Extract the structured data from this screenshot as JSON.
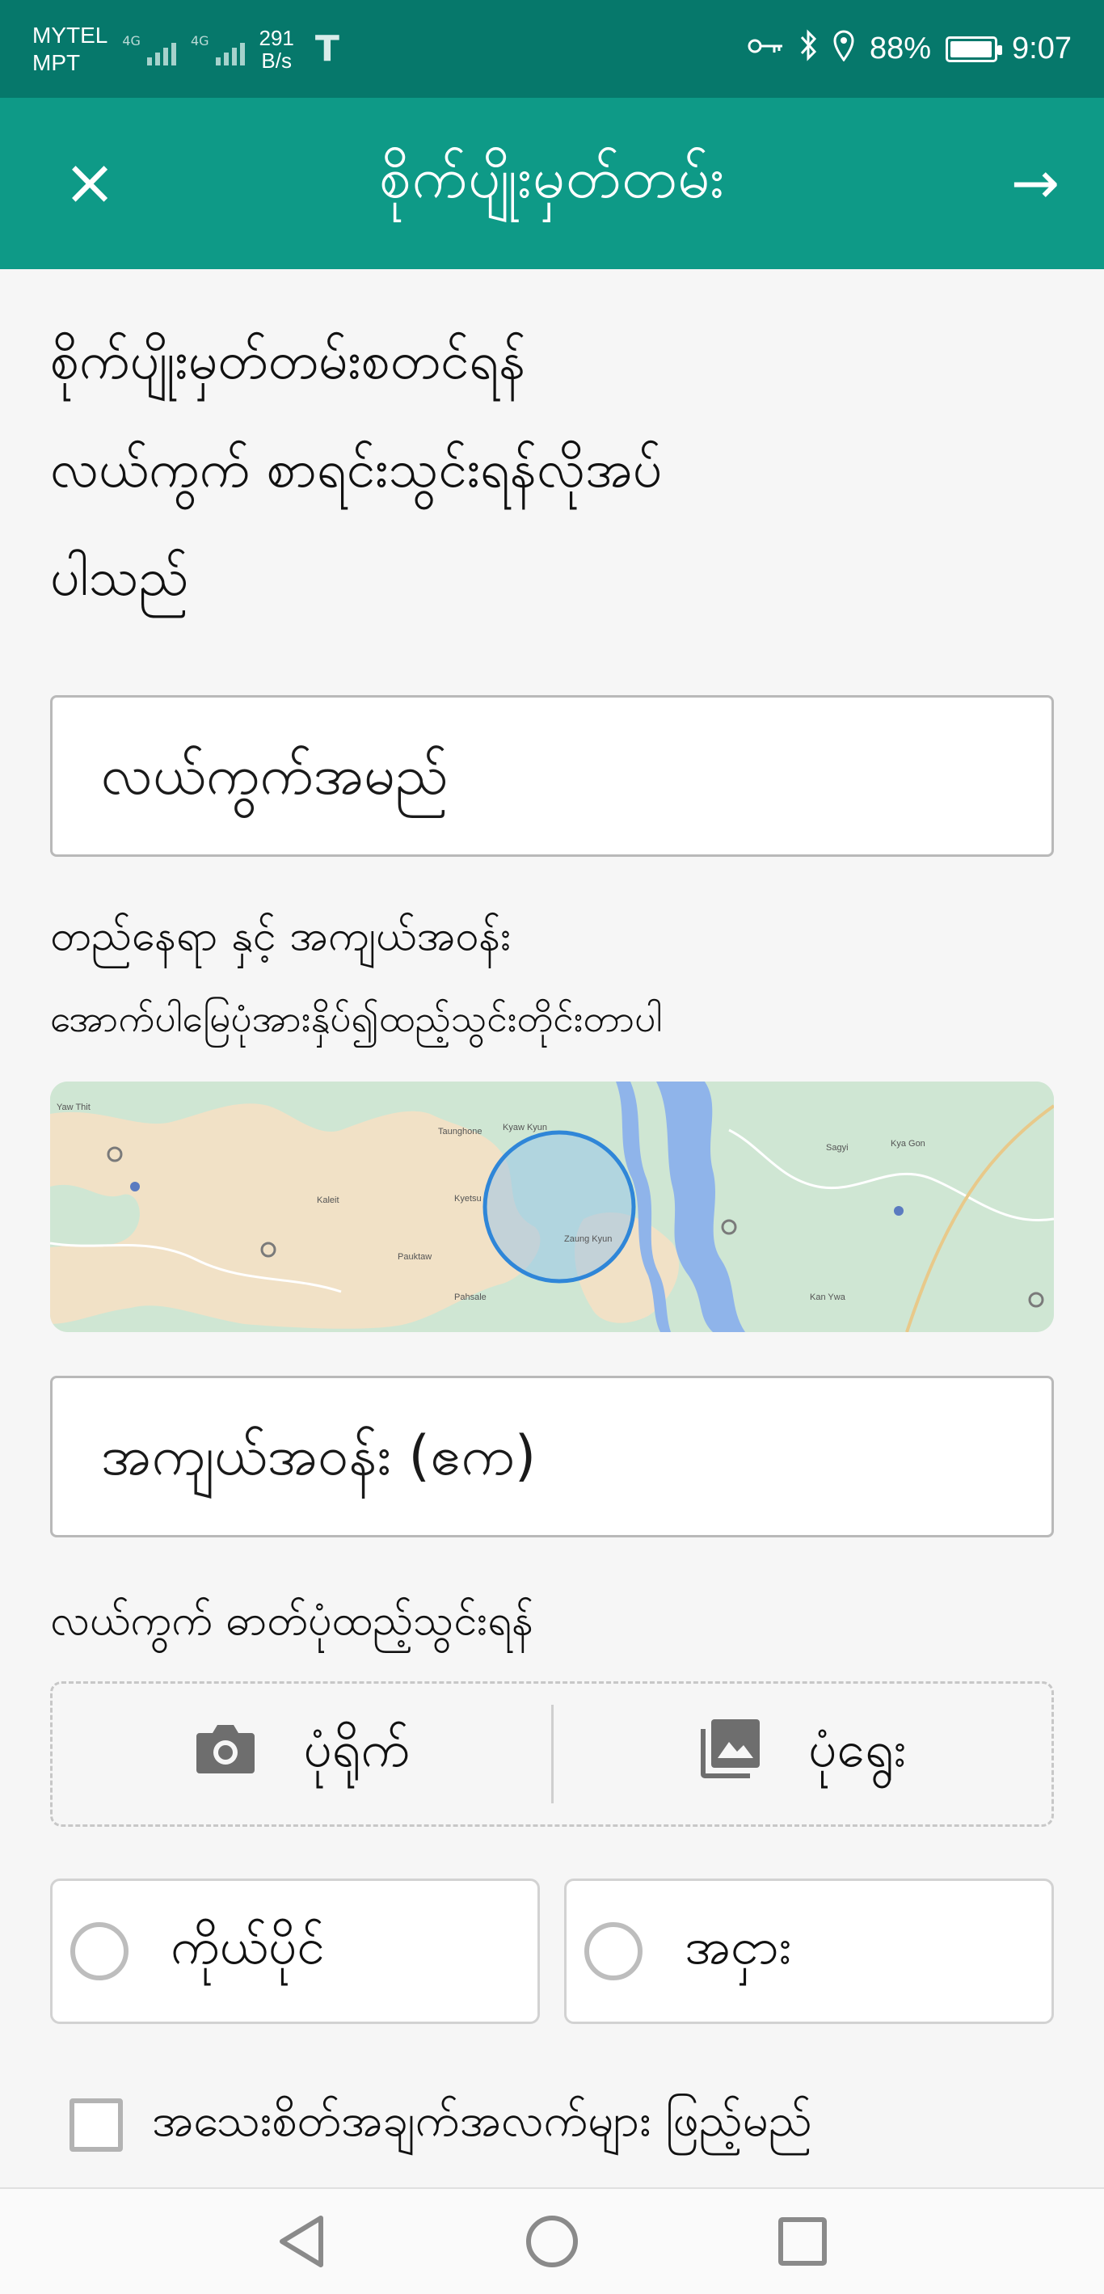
{
  "status_bar": {
    "carrier_1": "MYTEL",
    "carrier_2": "MPT",
    "net_1": "4G",
    "net_2": "4G",
    "speed_value": "291",
    "speed_unit": "B/s",
    "app_icon": "T",
    "battery_percent": "88%",
    "battery_level": 0.88,
    "time": "9:07",
    "icons": [
      "key-icon",
      "bluetooth-icon",
      "location-icon",
      "battery-icon"
    ]
  },
  "app_bar": {
    "title": "စိုက်ပျိုးမှတ်တမ်း",
    "close_icon": "×",
    "next_icon": "→"
  },
  "form": {
    "intro_line_1": "စိုက်ပျိုးမှတ်တမ်းစတင်ရန်",
    "intro_line_2": "လယ်ကွက် စာရင်းသွင်းရန်လိုအပ်",
    "intro_line_3": "ပါသည်",
    "field_name_placeholder": "လယ်ကွက်အမည်",
    "location_label": "တည်နေရာ နှင့် အကျယ်အဝန်း",
    "location_hint": "အောက်ပါမြေပုံအားနှိပ်၍ထည့်သွင်းတိုင်းတာပါ",
    "area_placeholder": "အကျယ်အဝန်း (ဧက)",
    "photo_label": "လယ်ကွက် ဓာတ်ပုံထည့်သွင်းရန်",
    "take_photo": "ပုံရိုက်",
    "choose_photo": "ပုံရွေး",
    "ownership_options": [
      "ကိုယ်ပိုင်",
      "အငှား"
    ],
    "details_checkbox": "အသေးစိတ်အချက်အလက်များ ဖြည့်မည်"
  },
  "map": {
    "place_labels": [
      "Yaw Thit",
      "Taunghone",
      "Kyaw Kyun",
      "Kyetsu",
      "Kaleit",
      "Pauktaw",
      "Zaung Kyun",
      "Pahsale",
      "Kan Ywa",
      "Sagyi",
      "Kya Gon"
    ]
  },
  "colors": {
    "status_bar": "#06786b",
    "app_bar": "#0e9a87",
    "background": "#f6f6f6",
    "map_circle": "#2f86d8"
  }
}
